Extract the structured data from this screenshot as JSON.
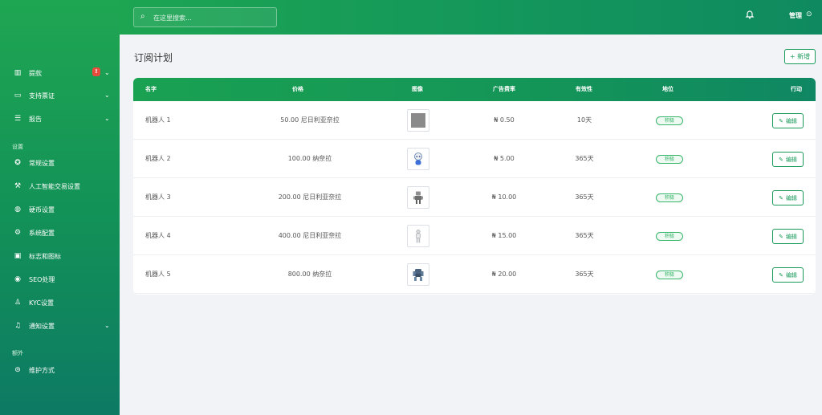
{
  "header": {
    "search_placeholder": "在这里搜索...",
    "admin_label": "管理",
    "admin_dropdown_glyph": "⊙"
  },
  "sidebar": {
    "items_top": [
      {
        "label": "提款",
        "icon": "bank-icon",
        "glyph": "▥",
        "badge": "!",
        "has_chevron": true
      },
      {
        "label": "支持票证",
        "icon": "ticket-icon",
        "glyph": "▭",
        "has_chevron": true
      },
      {
        "label": "报告",
        "icon": "list-icon",
        "glyph": "☰",
        "has_chevron": true
      }
    ],
    "section_settings": "设置",
    "items_settings": [
      {
        "label": "常规设置",
        "icon": "general-settings-icon",
        "glyph": "✪"
      },
      {
        "label": "人工智能交易设置",
        "icon": "hammer-icon",
        "glyph": "⚒"
      },
      {
        "label": "硬币设置",
        "icon": "coins-icon",
        "glyph": "◍"
      },
      {
        "label": "系统配置",
        "icon": "cog-icon",
        "glyph": "⚙"
      },
      {
        "label": "标志和图标",
        "icon": "images-icon",
        "glyph": "▣"
      },
      {
        "label": "SEO处理",
        "icon": "globe-icon",
        "glyph": "◉"
      },
      {
        "label": "KYC设置",
        "icon": "user-check-icon",
        "glyph": "♙"
      },
      {
        "label": "通知设置",
        "icon": "bell-icon",
        "glyph": "♫",
        "has_chevron": true
      }
    ],
    "section_extra": "额外",
    "items_extra": [
      {
        "label": "维护方式",
        "icon": "robot-icon",
        "glyph": "⊜"
      }
    ]
  },
  "page": {
    "title": "订阅计划",
    "add_button_label": "+ 新增"
  },
  "table": {
    "columns": [
      "名字",
      "价格",
      "图像",
      "广告费率",
      "有效性",
      "地位",
      "行动"
    ],
    "rows": [
      {
        "name": "机器人 1",
        "price": "50.00 尼日利亚奈拉",
        "image": "gray-placeholder",
        "rate": "₦ 0.50",
        "validity": "10天",
        "status": "积极",
        "action": "编辑"
      },
      {
        "name": "机器人 2",
        "price": "100.00 纳奈拉",
        "image": "robot-blue",
        "rate": "₦ 5.00",
        "validity": "365天",
        "status": "积极",
        "action": "编辑"
      },
      {
        "name": "机器人 3",
        "price": "200.00 尼日利亚奈拉",
        "image": "robot-gray",
        "rate": "₦ 10.00",
        "validity": "365天",
        "status": "积极",
        "action": "编辑"
      },
      {
        "name": "机器人 4",
        "price": "400.00 尼日利亚奈拉",
        "image": "robot-white",
        "rate": "₦ 15.00",
        "validity": "365天",
        "status": "积极",
        "action": "编辑"
      },
      {
        "name": "机器人 5",
        "price": "800.00 纳奈拉",
        "image": "robot-mech",
        "rate": "₦ 20.00",
        "validity": "365天",
        "status": "积极",
        "action": "编辑"
      }
    ]
  },
  "colors": {
    "brand_green": "#1a9b5a",
    "status_green": "#37b56b",
    "badge_red": "#e74c3c"
  }
}
